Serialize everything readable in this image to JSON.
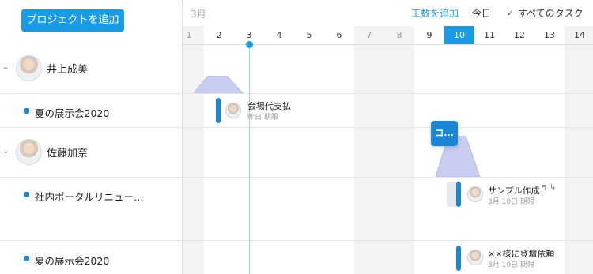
{
  "toolbar": {
    "add_project_label": "プロジェクトを追加",
    "month_label": "3月",
    "add_hours_label": "工数を追加",
    "today_label": "今日",
    "all_tasks_label": "すべてのタスク"
  },
  "days": [
    "1",
    "2",
    "3",
    "4",
    "5",
    "6",
    "7",
    "8",
    "9",
    "10",
    "11",
    "12",
    "13",
    "14"
  ],
  "selected_day": "10",
  "rows": {
    "person1": "井上成美",
    "project1": "夏の展示会2020",
    "person2": "佐藤加奈",
    "project2": "社内ポータルリニュー…",
    "project3": "夏の展示会2020"
  },
  "tasks": {
    "t1_name": "会場代支払",
    "t1_due": "昨日 期限",
    "t2_name": "サンプル作成",
    "t2_count": "5",
    "t2_due": "3月 10日 期限",
    "t3_name": "××様に登壇依頼",
    "t3_due": "3月 10日 期限",
    "chip_label": "コ..."
  },
  "colors": {
    "accent": "#1a9be6",
    "task_bar": "#1a87d6",
    "workload": "#c9cdf2"
  }
}
